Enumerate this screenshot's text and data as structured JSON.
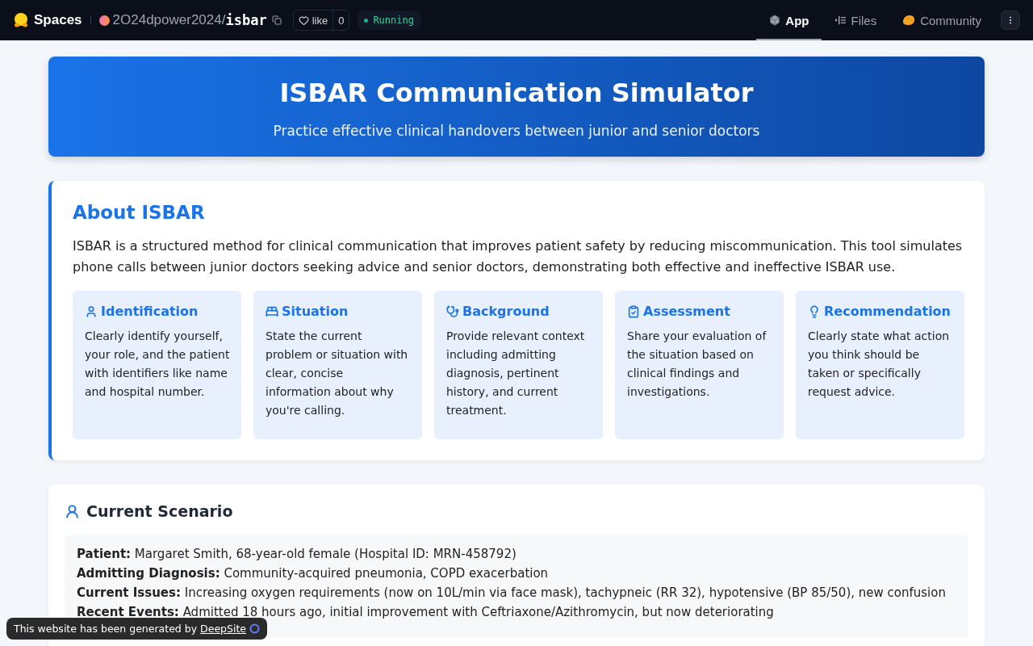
{
  "topbar": {
    "brand": "Spaces",
    "owner": "2O24dpower2024",
    "separator": "/",
    "repo": "isbar",
    "like_label": "like",
    "like_count": "0",
    "status": "Running",
    "tabs": [
      {
        "label": "App",
        "selected": true
      },
      {
        "label": "Files",
        "selected": false
      },
      {
        "label": "Community",
        "selected": false
      }
    ]
  },
  "header": {
    "title": "ISBAR Communication Simulator",
    "subtitle": "Practice effective clinical handovers between junior and senior doctors"
  },
  "about": {
    "title": "About ISBAR",
    "text": "ISBAR is a structured method for clinical communication that improves patient safety by reducing miscommunication. This tool simulates phone calls between junior doctors seeking advice and senior doctors, demonstrating both effective and ineffective ISBAR use.",
    "cards": [
      {
        "title": "Identification",
        "text": "Clearly identify yourself, your role, and the patient with identifiers like name and hospital number."
      },
      {
        "title": "Situation",
        "text": "State the current problem or situation with clear, concise information about why you're calling."
      },
      {
        "title": "Background",
        "text": "Provide relevant context including admitting diagnosis, pertinent history, and current treatment."
      },
      {
        "title": "Assessment",
        "text": "Share your evaluation of the situation based on clinical findings and investigations."
      },
      {
        "title": "Recommendation",
        "text": "Clearly state what action you think should be taken or specifically request advice."
      }
    ]
  },
  "scenario": {
    "title": "Current Scenario",
    "lines": [
      {
        "label": "Patient:",
        "text": "Margaret Smith, 68-year-old female (Hospital ID: MRN-458792)"
      },
      {
        "label": "Admitting Diagnosis:",
        "text": "Community-acquired pneumonia, COPD exacerbation"
      },
      {
        "label": "Current Issues:",
        "text": "Increasing oxygen requirements (now on 10L/min via face mask), tachypneic (RR 32), hypotensive (BP 85/50), new confusion"
      },
      {
        "label": "Recent Events:",
        "text": "Admitted 18 hours ago, initial improvement with Ceftriaxone/Azithromycin, but now deteriorating"
      }
    ]
  },
  "badge": {
    "text": "This website has been generated by",
    "link": "DeepSite"
  }
}
